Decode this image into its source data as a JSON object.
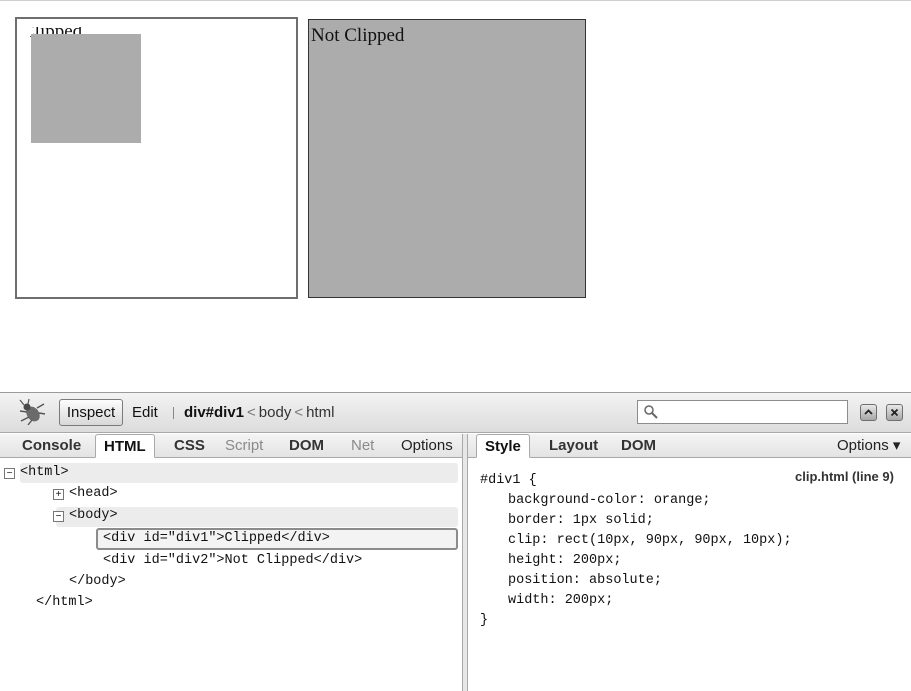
{
  "page": {
    "div1_text": "Clipped",
    "div2_text": "Not Clipped"
  },
  "toolbar": {
    "inspect_label": "Inspect",
    "edit_label": "Edit",
    "breadcrumb": [
      "div#div1",
      "body",
      "html"
    ],
    "search_value": ""
  },
  "left_tabs": [
    "Console",
    "HTML",
    "CSS",
    "Script",
    "DOM",
    "Net",
    "Options"
  ],
  "right_tabs": [
    "Style",
    "Layout",
    "DOM",
    "Options"
  ],
  "html_tree": {
    "html_open": "<html>",
    "head": "<head>",
    "body_open": "<body>",
    "div1_tag": "<div id=\"div1\">",
    "div1_text": "Clipped",
    "div_close": "</div>",
    "div2_tag": "<div id=\"div2\">",
    "div2_text": "Not Clipped",
    "body_close": "</body>",
    "html_close": "</html>"
  },
  "style_panel": {
    "selector": "#div1 {",
    "source": "clip.html (line 9)",
    "rules": [
      "background-color: orange;",
      "border: 1px solid;",
      "clip: rect(10px, 90px, 90px, 10px);",
      "height: 200px;",
      "position: absolute;",
      "width: 200px;"
    ],
    "close": "}"
  }
}
